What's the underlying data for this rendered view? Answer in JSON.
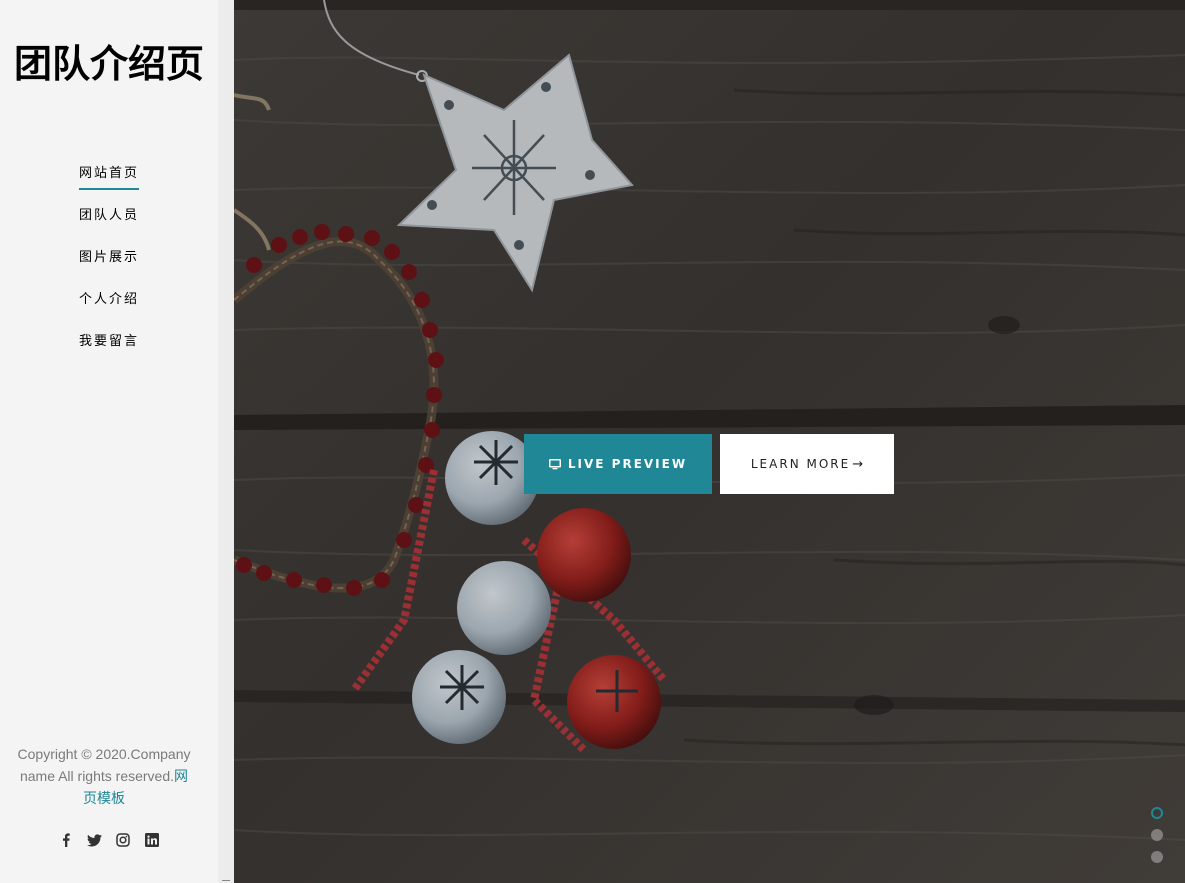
{
  "site": {
    "title": "团队介绍页"
  },
  "nav": [
    {
      "label": "网站首页",
      "active": true
    },
    {
      "label": "团队人员",
      "active": false
    },
    {
      "label": "图片展示",
      "active": false
    },
    {
      "label": "个人介绍",
      "active": false
    },
    {
      "label": "我要留言",
      "active": false
    }
  ],
  "footer": {
    "copyright": "Copyright © 2020.Company name All rights reserved.",
    "template_link": "网页模板"
  },
  "social": [
    "facebook-icon",
    "twitter-icon",
    "instagram-icon",
    "linkedin-icon"
  ],
  "hero": {
    "preview_label": "LIVE PREVIEW",
    "learn_label": "LEARN MORE",
    "slides": 3,
    "active_slide": 1
  },
  "colors": {
    "accent": "#1f8796",
    "sidebar_bg": "#f4f4f4"
  }
}
